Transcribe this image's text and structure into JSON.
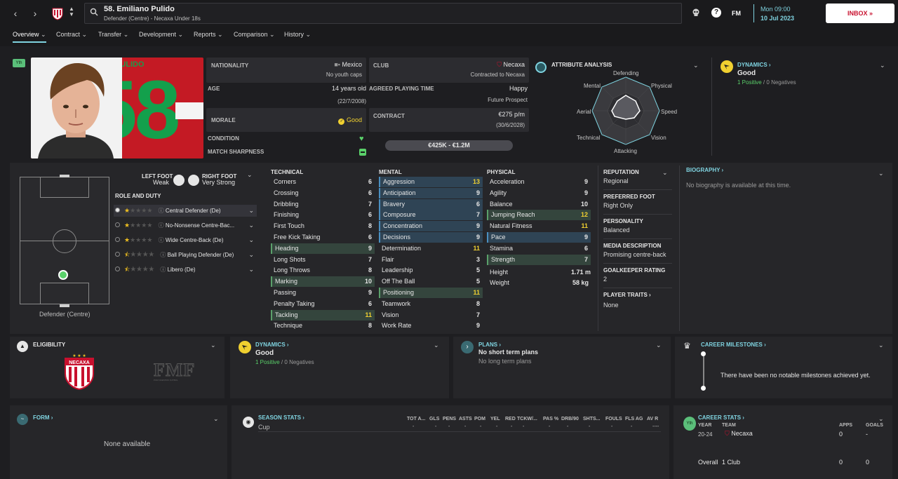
{
  "header": {
    "player_name": "58. Emiliano Pulido",
    "player_sub": "Defender (Centre) - Necaxa Under 18s",
    "date_day": "Mon 09:00",
    "date": "10 Jul 2023",
    "inbox": "INBOX",
    "fm_label": "FM"
  },
  "tabs": [
    "Overview",
    "Contract",
    "Transfer",
    "Development",
    "Reports",
    "Comparison",
    "History"
  ],
  "profile": {
    "badge_yth": "Yth",
    "shirt_name": "PULIDO",
    "shirt_number": "58",
    "nationality_label": "NATIONALITY",
    "nationality": "Mexico",
    "youth_caps": "No youth caps",
    "age_label": "AGE",
    "age": "14 years old",
    "dob": "(22/7/2008)",
    "morale_label": "MORALE",
    "morale": "Good",
    "condition_label": "CONDITION",
    "sharpness_label": "MATCH SHARPNESS",
    "club_label": "CLUB",
    "club": "Necaxa",
    "club_status": "Contracted to Necaxa",
    "playing_time_label": "AGREED PLAYING TIME",
    "playing_time": "Happy",
    "playing_time_sub": "Future Prospect",
    "contract_label": "CONTRACT",
    "wage": "€275 p/m",
    "contract_end": "(30/6/2028)",
    "value": "€425K - €1.2M"
  },
  "attribute_analysis": {
    "title": "ATTRIBUTE ANALYSIS",
    "labels": [
      "Defending",
      "Physical",
      "Speed",
      "Vision",
      "Attacking",
      "Technical",
      "Aerial",
      "Mental"
    ]
  },
  "dynamics_top": {
    "title": "DYNAMICS",
    "value": "Good",
    "positive": "1 Positive",
    "negative": "0 Negatives"
  },
  "feet": {
    "left_label": "LEFT FOOT",
    "left": "Weak",
    "right_label": "RIGHT FOOT",
    "right": "Very Strong"
  },
  "role_duty_title": "ROLE AND DUTY",
  "roles": [
    {
      "name": "Central Defender (De)",
      "stars": 1
    },
    {
      "name": "No-Nonsense Centre-Bac...",
      "stars": 1
    },
    {
      "name": "Wide Centre-Back (De)",
      "stars": 1
    },
    {
      "name": "Ball Playing Defender (De)",
      "stars": 0.5
    },
    {
      "name": "Libero (De)",
      "stars": 0.5
    }
  ],
  "pitch_position": "Defender (Centre)",
  "technical": {
    "title": "TECHNICAL",
    "items": [
      {
        "n": "Corners",
        "v": "6",
        "h": ""
      },
      {
        "n": "Crossing",
        "v": "6",
        "h": ""
      },
      {
        "n": "Dribbling",
        "v": "7",
        "h": ""
      },
      {
        "n": "Finishing",
        "v": "6",
        "h": ""
      },
      {
        "n": "First Touch",
        "v": "8",
        "h": ""
      },
      {
        "n": "Free Kick Taking",
        "v": "6",
        "h": ""
      },
      {
        "n": "Heading",
        "v": "9",
        "h": "g"
      },
      {
        "n": "Long Shots",
        "v": "7",
        "h": ""
      },
      {
        "n": "Long Throws",
        "v": "8",
        "h": ""
      },
      {
        "n": "Marking",
        "v": "10",
        "h": "g"
      },
      {
        "n": "Passing",
        "v": "9",
        "h": ""
      },
      {
        "n": "Penalty Taking",
        "v": "6",
        "h": ""
      },
      {
        "n": "Tackling",
        "v": "11",
        "h": "g"
      },
      {
        "n": "Technique",
        "v": "8",
        "h": ""
      }
    ]
  },
  "mental": {
    "title": "MENTAL",
    "items": [
      {
        "n": "Aggression",
        "v": "13",
        "h": "b"
      },
      {
        "n": "Anticipation",
        "v": "9",
        "h": "b"
      },
      {
        "n": "Bravery",
        "v": "6",
        "h": "b"
      },
      {
        "n": "Composure",
        "v": "7",
        "h": "b"
      },
      {
        "n": "Concentration",
        "v": "9",
        "h": "b"
      },
      {
        "n": "Decisions",
        "v": "9",
        "h": "b"
      },
      {
        "n": "Determination",
        "v": "11",
        "h": ""
      },
      {
        "n": "Flair",
        "v": "3",
        "h": ""
      },
      {
        "n": "Leadership",
        "v": "5",
        "h": ""
      },
      {
        "n": "Off The Ball",
        "v": "5",
        "h": ""
      },
      {
        "n": "Positioning",
        "v": "11",
        "h": "g"
      },
      {
        "n": "Teamwork",
        "v": "8",
        "h": ""
      },
      {
        "n": "Vision",
        "v": "7",
        "h": ""
      },
      {
        "n": "Work Rate",
        "v": "9",
        "h": ""
      }
    ]
  },
  "physical": {
    "title": "PHYSICAL",
    "items": [
      {
        "n": "Acceleration",
        "v": "9",
        "h": ""
      },
      {
        "n": "Agility",
        "v": "9",
        "h": ""
      },
      {
        "n": "Balance",
        "v": "10",
        "h": ""
      },
      {
        "n": "Jumping Reach",
        "v": "12",
        "h": "g"
      },
      {
        "n": "Natural Fitness",
        "v": "11",
        "h": ""
      },
      {
        "n": "Pace",
        "v": "9",
        "h": "b"
      },
      {
        "n": "Stamina",
        "v": "6",
        "h": ""
      },
      {
        "n": "Strength",
        "v": "7",
        "h": "g"
      }
    ],
    "height_label": "Height",
    "height": "1.71 m",
    "weight_label": "Weight",
    "weight": "58 kg"
  },
  "info": {
    "reputation_label": "REPUTATION",
    "reputation": "Regional",
    "foot_label": "PREFERRED FOOT",
    "foot": "Right Only",
    "personality_label": "PERSONALITY",
    "personality": "Balanced",
    "media_label": "MEDIA DESCRIPTION",
    "media": "Promising centre-back",
    "gk_label": "GOALKEEPER RATING",
    "gk": "2",
    "traits_label": "PLAYER TRAITS",
    "traits": "None"
  },
  "biography": {
    "title": "BIOGRAPHY",
    "text": "No biography is available at this time."
  },
  "eligibility": {
    "title": "ELIGIBILITY",
    "club_logo": "NECAXA",
    "fmf_logo": "FMF",
    "fmf_sub": "POR NUESTRO FUTBOL"
  },
  "dynamics_bottom": {
    "title": "DYNAMICS",
    "value": "Good",
    "positive": "1 Positive",
    "negative": "0 Negatives"
  },
  "plans": {
    "title": "PLANS",
    "short": "No short term plans",
    "long": "No long term plans"
  },
  "milestones": {
    "title": "CAREER MILESTONES",
    "text": "There have been no notable milestones achieved yet."
  },
  "form": {
    "title": "FORM",
    "text": "None available"
  },
  "season_stats": {
    "title": "SEASON STATS",
    "columns": [
      "TOT A...",
      "GLS",
      "PENS",
      "ASTS",
      "POM",
      "YEL",
      "RED",
      "TCKW/...",
      "PAS %",
      "DRB/90",
      "SHTS...",
      "FOULS",
      "FLS AG",
      "AV R"
    ],
    "row_label": "Cup",
    "row_values": [
      "-",
      "-",
      "-",
      "-",
      "-",
      "-",
      "-",
      "-",
      "-",
      "-",
      "-",
      "-",
      "-",
      "----"
    ]
  },
  "career_stats": {
    "title": "CAREER STATS",
    "year_h": "YEAR",
    "team_h": "TEAM",
    "apps_h": "APPS",
    "goals_h": "GOALS",
    "year": "20-24",
    "team": "Necaxa",
    "apps": "0",
    "goals": "-",
    "overall": "Overall",
    "overall_clubs": "1 Club",
    "overall_apps": "0",
    "overall_goals": "0",
    "badge": "Yth"
  },
  "colors": {
    "accent": "#7fd3e0",
    "positive": "#5ad06a",
    "highlight_yellow": "#f0d030",
    "brand_red": "#c8102e"
  }
}
